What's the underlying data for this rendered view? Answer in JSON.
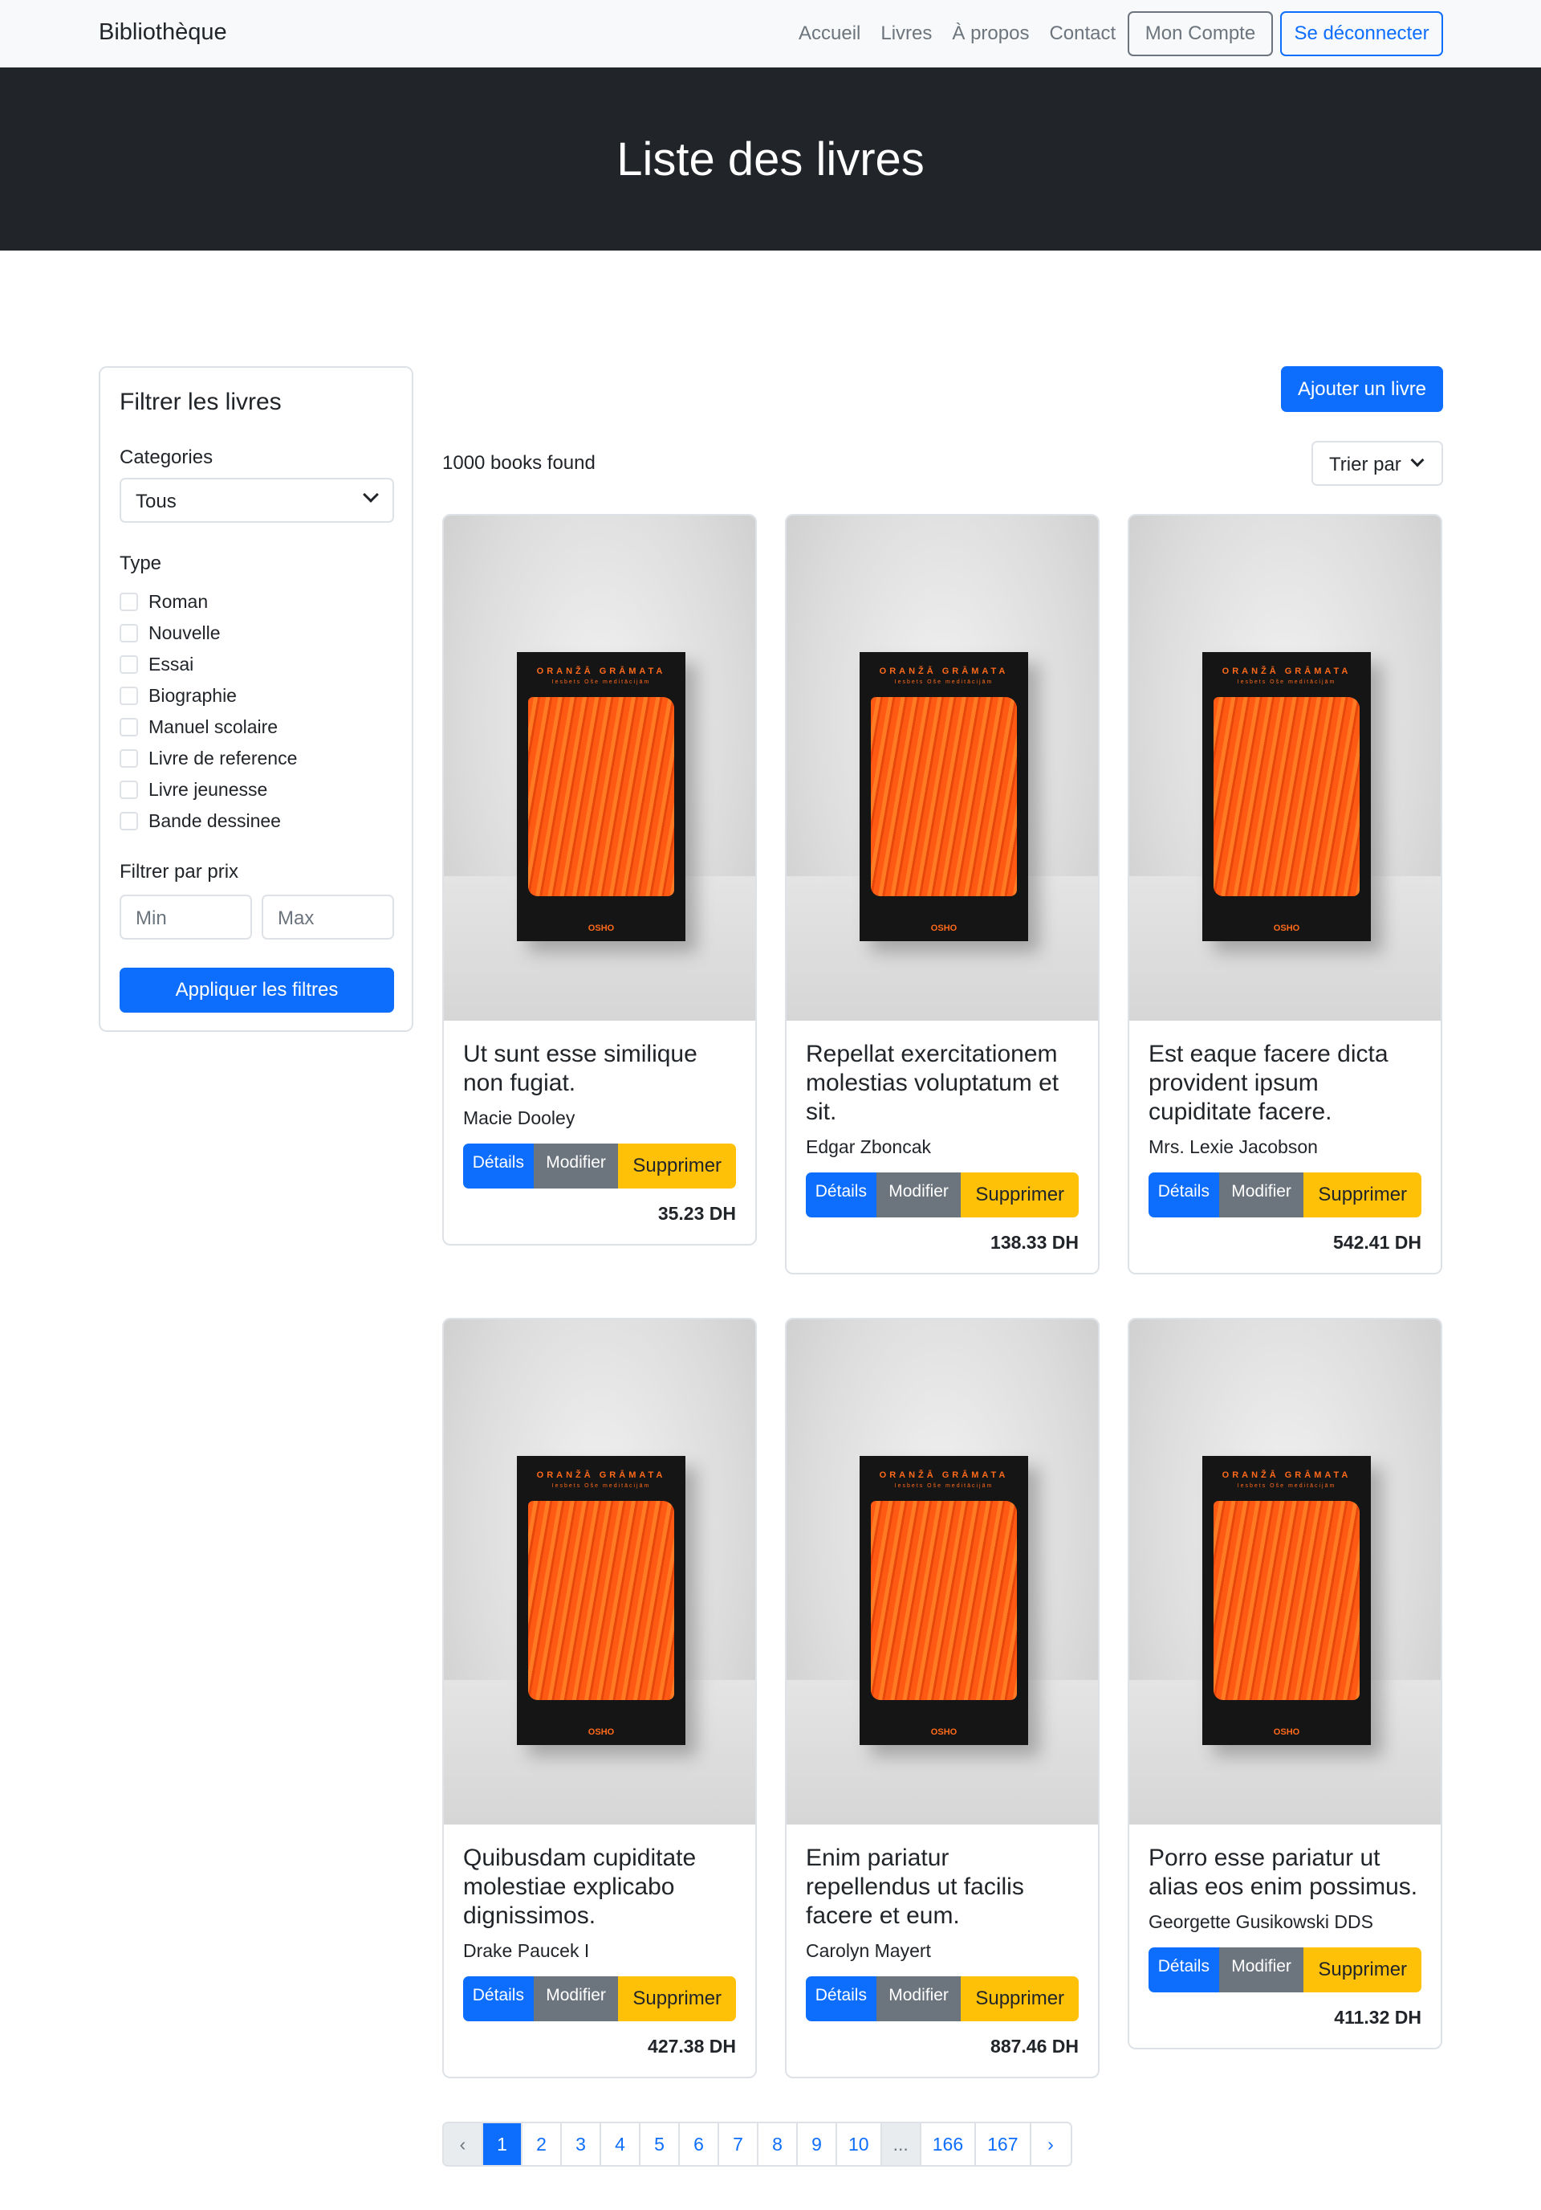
{
  "navbar": {
    "brand": "Bibliothèque",
    "links": [
      "Accueil",
      "Livres",
      "À propos",
      "Contact"
    ],
    "account_button": "Mon Compte",
    "logout_button": "Se déconnecter"
  },
  "hero": {
    "title": "Liste des livres"
  },
  "sidebar": {
    "title": "Filtrer les livres",
    "categories_label": "Categories",
    "categories_selected": "Tous",
    "type_label": "Type",
    "types": [
      "Roman",
      "Nouvelle",
      "Essai",
      "Biographie",
      "Manuel scolaire",
      "Livre de reference",
      "Livre jeunesse",
      "Bande dessinee"
    ],
    "price_label": "Filtrer par prix",
    "min_placeholder": "Min",
    "max_placeholder": "Max",
    "apply_button": "Appliquer les filtres"
  },
  "toolbar": {
    "add_button": "Ajouter un livre",
    "count_text": "1000 books found",
    "sort_label": "Trier par"
  },
  "book_cover": {
    "title": "ORANŽĀ GRĀMATA",
    "subtitle": "Iesbets Oše meditācijām",
    "publisher": "OSHO"
  },
  "card_buttons": {
    "details": "Détails",
    "edit": "Modifier",
    "delete": "Supprimer"
  },
  "books": [
    {
      "title": "Ut sunt esse similique non fugiat.",
      "author": "Macie Dooley",
      "price": "35.23 DH"
    },
    {
      "title": "Repellat exercitationem molestias voluptatum et sit.",
      "author": "Edgar Zboncak",
      "price": "138.33 DH"
    },
    {
      "title": "Est eaque facere dicta provident ipsum cupiditate facere.",
      "author": "Mrs. Lexie Jacobson",
      "price": "542.41 DH"
    },
    {
      "title": "Quibusdam cupiditate molestiae explicabo dignissimos.",
      "author": "Drake Paucek I",
      "price": "427.38 DH"
    },
    {
      "title": "Enim pariatur repellendus ut facilis facere et eum.",
      "author": "Carolyn Mayert",
      "price": "887.46 DH"
    },
    {
      "title": "Porro esse pariatur ut alias eos enim possimus.",
      "author": "Georgette Gusikowski DDS",
      "price": "411.32 DH"
    }
  ],
  "pagination": {
    "prev": "‹",
    "pages": [
      "1",
      "2",
      "3",
      "4",
      "5",
      "6",
      "7",
      "8",
      "9",
      "10",
      "...",
      "166",
      "167"
    ],
    "next": "›",
    "active": "1"
  },
  "colors": {
    "primary": "#0d6efd",
    "secondary": "#6c757d",
    "warning": "#ffc107",
    "dark": "#212529"
  }
}
